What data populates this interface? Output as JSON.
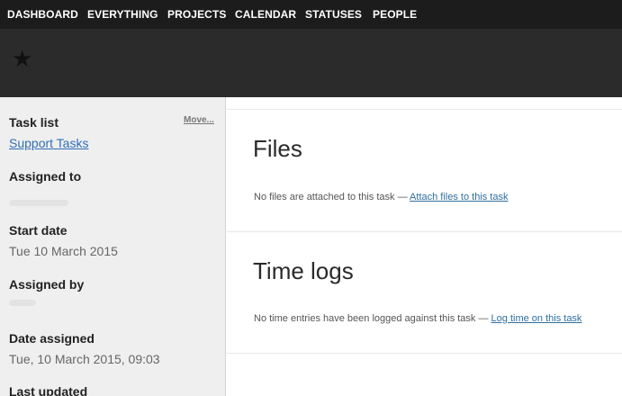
{
  "nav": {
    "items": [
      "DASHBOARD",
      "EVERYTHING",
      "PROJECTS",
      "CALENDAR",
      "STATUSES",
      "PEOPLE"
    ]
  },
  "header": {
    "star_icon": "star-icon"
  },
  "sidebar": {
    "task_list_label": "Task list",
    "move_link": "Move...",
    "task_list_value": "Support Tasks",
    "assigned_to_label": "Assigned to",
    "start_date_label": "Start date",
    "start_date_value": "Tue 10 March 2015",
    "assigned_by_label": "Assigned by",
    "date_assigned_label": "Date assigned",
    "date_assigned_value": "Tue, 10 March 2015, 09:03",
    "last_updated_label": "Last updated"
  },
  "files": {
    "title": "Files",
    "empty_text": "No files are attached to this task —",
    "attach_link": "Attach files to this task"
  },
  "time_logs": {
    "title": "Time logs",
    "empty_text": "No time entries have been logged against this task —",
    "log_link": "Log time on this task"
  },
  "colors": {
    "nav_bg": "#1c1c1c",
    "header_bg": "#2b2b2b",
    "sidebar_bg": "#efefef",
    "link": "#2f6fb8"
  }
}
